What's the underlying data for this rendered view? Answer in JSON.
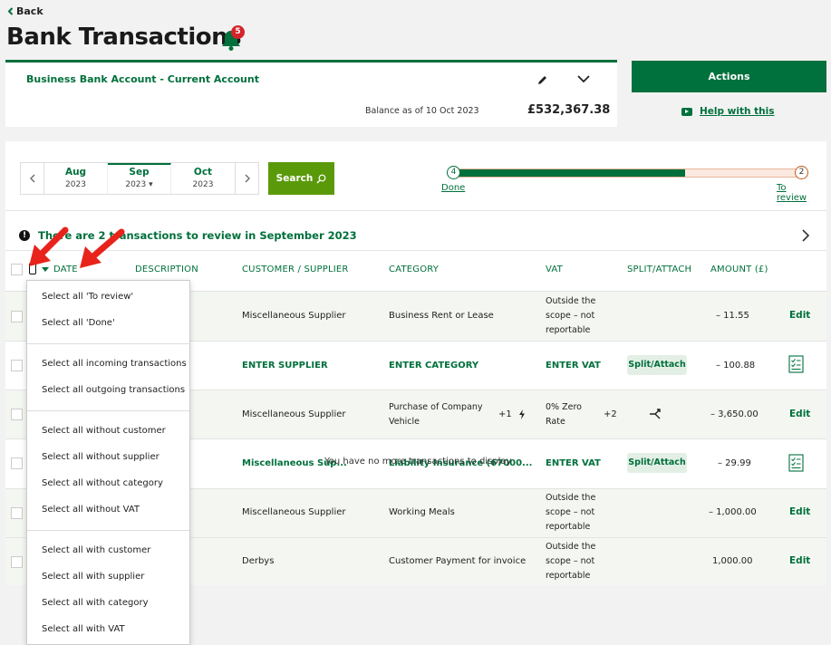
{
  "header": {
    "back_label": "Back",
    "title": "Bank Transactions",
    "notification_count": "5"
  },
  "account": {
    "name": "Business Bank Account - Current Account",
    "balance_label": "Balance as of 10 Oct 2023",
    "balance_value": "£532,367.38"
  },
  "actions": {
    "actions_label": "Actions",
    "help_label": "Help with this"
  },
  "month_nav": {
    "months": [
      {
        "month": "Aug",
        "year": "2023"
      },
      {
        "month": "Sep",
        "year": "2023 ▾"
      },
      {
        "month": "Oct",
        "year": "2023"
      }
    ],
    "search_label": "Search"
  },
  "progress": {
    "done_count": "4",
    "review_count": "2",
    "done_label": "Done",
    "review_label": "To review",
    "done_fraction": 0.67
  },
  "banner": {
    "text": "There are 2 transactions to review in September 2023"
  },
  "table": {
    "headers": {
      "date": "DATE",
      "description": "DESCRIPTION",
      "customer_supplier": "CUSTOMER / SUPPLIER",
      "category": "CATEGORY",
      "vat": "VAT",
      "split_attach": "SPLIT/ATTACH",
      "amount": "AMOUNT (£)"
    },
    "rows": [
      {
        "supplier": "Miscellaneous Supplier",
        "category": "Business Rent or Lease",
        "vat": [
          "Outside the",
          "scope – not",
          "reportable"
        ],
        "split": "",
        "amount": "– 11.55",
        "action": "Edit"
      },
      {
        "supplier": "ENTER SUPPLIER",
        "category": "ENTER CATEGORY",
        "vat": [
          "ENTER VAT"
        ],
        "split": "Split/Attach",
        "amount": "– 100.88",
        "action": ""
      },
      {
        "supplier": "Miscellaneous Supplier",
        "category": "Purchase of Company Vehicle",
        "category_extra": "+1",
        "vat": [
          "0% Zero",
          "Rate"
        ],
        "vat_extra": "+2",
        "split": "",
        "amount": "– 3,650.00",
        "action": "Edit"
      },
      {
        "supplier": "Miscellaneous Sup...",
        "category": "Liability Insurance (67000...",
        "vat": [
          "ENTER VAT"
        ],
        "split": "Split/Attach",
        "amount": "– 29.99",
        "action": ""
      },
      {
        "supplier": "Miscellaneous Supplier",
        "category": "Working Meals",
        "vat": [
          "Outside the",
          "scope – not",
          "reportable"
        ],
        "split": "",
        "amount": "– 1,000.00",
        "action": "Edit"
      },
      {
        "supplier": "Derbys",
        "category": "Customer Payment for invoice",
        "vat": [
          "Outside the",
          "scope – not",
          "reportable"
        ],
        "split": "",
        "amount": "1,000.00",
        "action": "Edit"
      }
    ],
    "empty_text": "You have no more transactions to display"
  },
  "dropdown": {
    "items": [
      "Select all 'To review'",
      "Select all 'Done'",
      "Select all incoming transactions",
      "Select all outgoing transactions",
      "Select all without customer",
      "Select all without supplier",
      "Select all without category",
      "Select all without VAT",
      "Select all with customer",
      "Select all with supplier",
      "Select all with category",
      "Select all with VAT"
    ]
  },
  "colors": {
    "brand_green": "#00703c",
    "search_green": "#5a9a0a",
    "badge_red": "#d4242b",
    "annotation_arrow": "#e8231b"
  }
}
